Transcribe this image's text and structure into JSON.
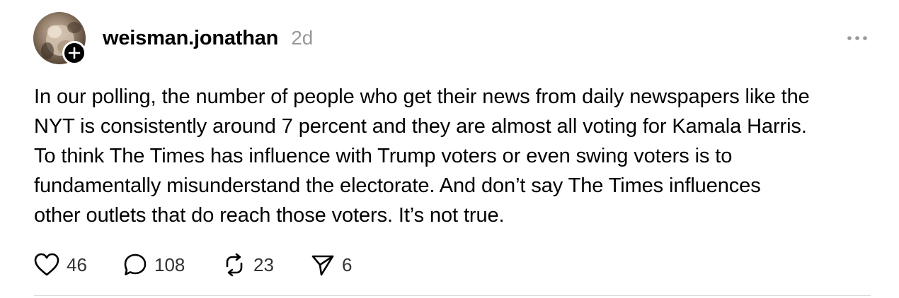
{
  "post": {
    "username": "weisman.jonathan",
    "timestamp": "2d",
    "body": "In our polling, the number of people who get their news from daily newspapers like the\nNYT is consistently around 7 percent and they are almost all voting for Kamala Harris.\nTo think The Times has influence with Trump voters or even swing voters is to\nfundamentally misunderstand the electorate. And don’t say The Times influences\nother outlets that do reach those voters. It’s not true.",
    "actions": {
      "likes": "46",
      "replies": "108",
      "reposts": "23",
      "shares": "6"
    }
  },
  "icons": {
    "avatar": "avatar",
    "follow": "plus-icon",
    "more": "more-horizontal-icon",
    "like": "heart-icon",
    "reply": "comment-icon",
    "repost": "repost-icon",
    "share": "send-icon"
  },
  "colors": {
    "text": "#000000",
    "muted": "#999999",
    "count": "#333333",
    "divider": "#dcdcdc"
  }
}
